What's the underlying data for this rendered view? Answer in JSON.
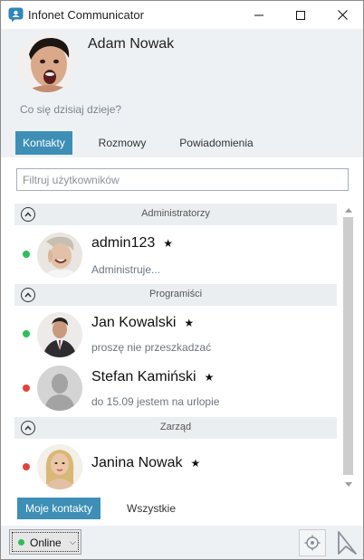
{
  "window": {
    "title": "Infonet Communicator"
  },
  "profile": {
    "name": "Adam Nowak",
    "status_message": "Co się dzisiaj dzieje?"
  },
  "tabs": [
    {
      "label": "Kontakty",
      "active": true
    },
    {
      "label": "Rozmowy",
      "active": false
    },
    {
      "label": "Powiadomienia",
      "active": false
    }
  ],
  "filter": {
    "placeholder": "Filtruj użytkowników",
    "value": ""
  },
  "groups": [
    {
      "title": "Administratorzy",
      "contacts": [
        {
          "name": "admin123",
          "favorite": "★",
          "description": "Administruje...",
          "status": "online",
          "status_color": "#2ebd59",
          "avatar": "photo-man-laughing"
        }
      ]
    },
    {
      "title": "Programiści",
      "contacts": [
        {
          "name": "Jan Kowalski",
          "favorite": "★",
          "description": "proszę nie przeszkadzać",
          "status": "online",
          "status_color": "#2ebd59",
          "avatar": "photo-man-suit"
        },
        {
          "name": "Stefan Kamiński",
          "favorite": "★",
          "description": "do 15.09 jestem na urlopie",
          "status": "away",
          "status_color": "#e0443c",
          "avatar": "default-avatar-icon"
        }
      ]
    },
    {
      "title": "Zarząd",
      "contacts": [
        {
          "name": "Janina Nowak",
          "favorite": "★",
          "description": "",
          "status": "away",
          "status_color": "#e0443c",
          "avatar": "photo-woman-blonde"
        }
      ]
    }
  ],
  "bottom_tabs": [
    {
      "label": "Moje kontakty",
      "active": true
    },
    {
      "label": "Wszystkie",
      "active": false
    }
  ],
  "footer": {
    "status_label": "Online",
    "status_color": "#2ebd59"
  },
  "colors": {
    "accent": "#3d8fb6",
    "online": "#2ebd59",
    "away": "#e0443c",
    "header_bg": "#eef1f4"
  }
}
